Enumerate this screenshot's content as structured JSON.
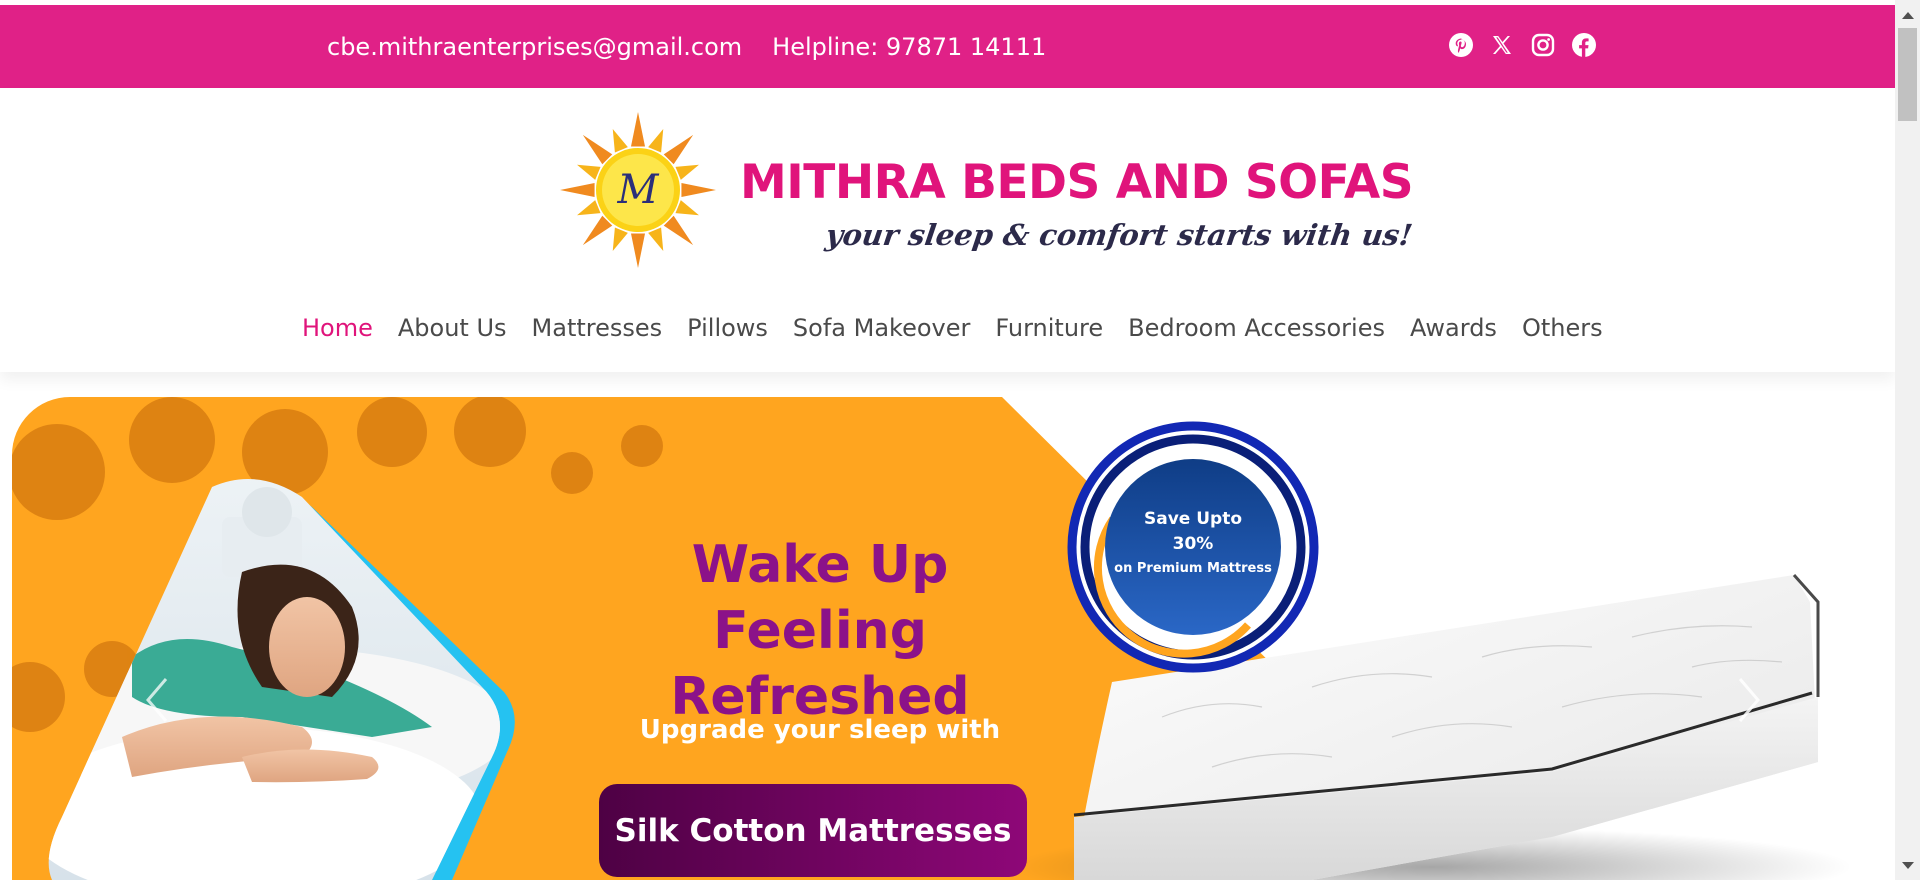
{
  "topbar": {
    "email": "cbe.mithraenterprises@gmail.com",
    "helpline": "Helpline: 97871 14111",
    "social": [
      "pinterest-icon",
      "x-icon",
      "instagram-icon",
      "facebook-icon"
    ],
    "background": "#e02187"
  },
  "logo": {
    "brand": "MITHRA BEDS AND SOFAS",
    "tagline": "your sleep & comfort starts with us!",
    "monogram": "M",
    "brand_color": "#e0147b"
  },
  "nav": {
    "items": [
      {
        "label": "Home",
        "active": true
      },
      {
        "label": "About Us"
      },
      {
        "label": "Mattresses"
      },
      {
        "label": "Pillows"
      },
      {
        "label": "Sofa Makeover"
      },
      {
        "label": "Furniture"
      },
      {
        "label": "Bedroom Accessories"
      },
      {
        "label": "Awards"
      },
      {
        "label": "Others"
      }
    ],
    "active_color": "#e0147b"
  },
  "banner": {
    "headline_line1": "Wake Up",
    "headline_line2": "Feeling Refreshed",
    "subline": "Upgrade your sleep with",
    "cta": "Silk Cotton Mattresses",
    "badge_line1": "Save Upto",
    "badge_line2": "30%",
    "badge_line3": "on Premium Mattress",
    "orange": "#ffa51f",
    "purple": "#8b1289"
  }
}
